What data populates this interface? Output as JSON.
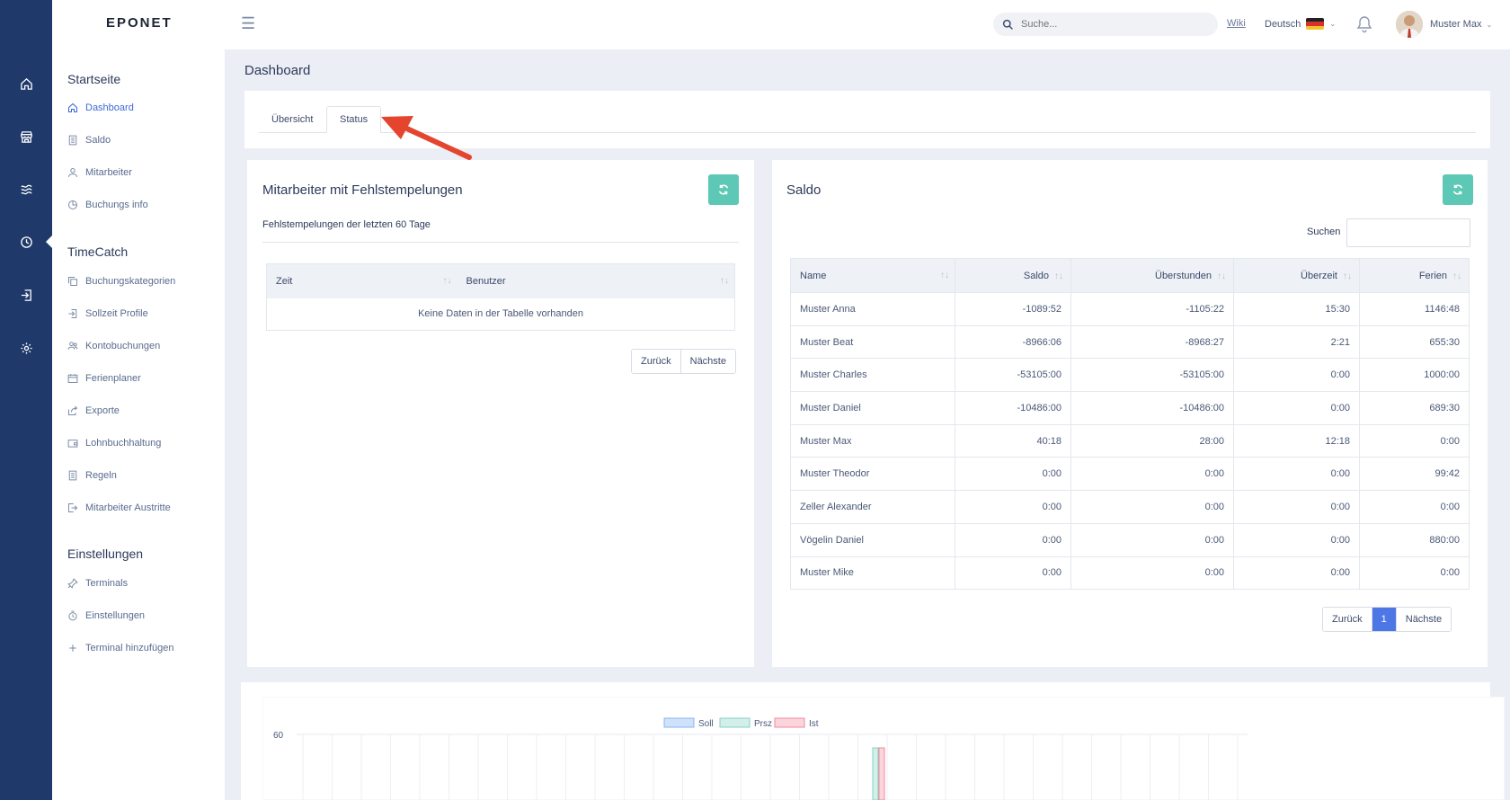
{
  "rail": {
    "icons": [
      "home-icon",
      "store-icon",
      "waves-icon",
      "clock-icon",
      "login-icon",
      "gear-icon"
    ]
  },
  "sidebar": {
    "logo": "EPONET",
    "sections": [
      {
        "title": "Startseite",
        "items": [
          {
            "label": "Dashboard",
            "icon": "home-icon",
            "active": true
          },
          {
            "label": "Saldo",
            "icon": "document-icon"
          },
          {
            "label": "Mitarbeiter",
            "icon": "user-icon"
          },
          {
            "label": "Buchungs info",
            "icon": "pie-icon"
          }
        ]
      },
      {
        "title": "TimeCatch",
        "items": [
          {
            "label": "Buchungskategorien",
            "icon": "copy-icon"
          },
          {
            "label": "Sollzeit Profile",
            "icon": "login-icon"
          },
          {
            "label": "Kontobuchungen",
            "icon": "users-icon"
          },
          {
            "label": "Ferienplaner",
            "icon": "calendar-icon"
          },
          {
            "label": "Exporte",
            "icon": "share-icon"
          },
          {
            "label": "Lohnbuchhaltung",
            "icon": "wallet-icon"
          },
          {
            "label": "Regeln",
            "icon": "document-icon"
          },
          {
            "label": "Mitarbeiter Austritte",
            "icon": "logout-icon"
          }
        ]
      },
      {
        "title": "Einstellungen",
        "items": [
          {
            "label": "Terminals",
            "icon": "pin-icon"
          },
          {
            "label": "Einstellungen",
            "icon": "stopwatch-icon"
          },
          {
            "label": "Terminal hinzufügen",
            "icon": "plus-icon"
          }
        ]
      }
    ]
  },
  "topbar": {
    "search_placeholder": "Suche...",
    "wiki": "Wiki",
    "language": "Deutsch",
    "user_name": "Muster Max"
  },
  "page": {
    "title": "Dashboard",
    "tabs": [
      "Übersicht",
      "Status"
    ],
    "selected_tab": "Status"
  },
  "fehlstempelungen": {
    "title": "Mitarbeiter mit Fehlstempelungen",
    "subtitle": "Fehlstempelungen der letzten 60 Tage",
    "columns": [
      "Zeit",
      "Benutzer"
    ],
    "empty_text": "Keine Daten in der Tabelle vorhanden",
    "prev": "Zurück",
    "next": "Nächste"
  },
  "saldo": {
    "title": "Saldo",
    "search_label": "Suchen",
    "columns": [
      "Name",
      "Saldo",
      "Überstunden",
      "Überzeit",
      "Ferien"
    ],
    "rows": [
      {
        "name": "Muster Anna",
        "saldo": "-1089:52",
        "ueberstunden": "-1105:22",
        "ueberzeit": "15:30",
        "ferien": "1146:48"
      },
      {
        "name": "Muster Beat",
        "saldo": "-8966:06",
        "ueberstunden": "-8968:27",
        "ueberzeit": "2:21",
        "ferien": "655:30"
      },
      {
        "name": "Muster Charles",
        "saldo": "-53105:00",
        "ueberstunden": "-53105:00",
        "ueberzeit": "0:00",
        "ferien": "1000:00"
      },
      {
        "name": "Muster Daniel",
        "saldo": "-10486:00",
        "ueberstunden": "-10486:00",
        "ueberzeit": "0:00",
        "ferien": "689:30"
      },
      {
        "name": "Muster Max",
        "saldo": "40:18",
        "ueberstunden": "28:00",
        "ueberzeit": "12:18",
        "ferien": "0:00"
      },
      {
        "name": "Muster Theodor",
        "saldo": "0:00",
        "ueberstunden": "0:00",
        "ueberzeit": "0:00",
        "ferien": "99:42"
      },
      {
        "name": "Zeller Alexander",
        "saldo": "0:00",
        "ueberstunden": "0:00",
        "ueberzeit": "0:00",
        "ferien": "0:00"
      },
      {
        "name": "Vögelin Daniel",
        "saldo": "0:00",
        "ueberstunden": "0:00",
        "ueberzeit": "0:00",
        "ferien": "880:00"
      },
      {
        "name": "Muster Mike",
        "saldo": "0:00",
        "ueberstunden": "0:00",
        "ueberzeit": "0:00",
        "ferien": "0:00"
      }
    ],
    "prev": "Zurück",
    "current_page": "1",
    "next": "Nächste"
  },
  "chart_data": {
    "type": "bar",
    "legend": [
      "Soll",
      "Prsz",
      "Ist"
    ],
    "legend_colors": [
      "#cfe2fb",
      "#d3efea",
      "#fbd5dc"
    ],
    "y_tick_top": "60"
  },
  "colors": {
    "rail": "#1f3a6a",
    "accent": "#3c6ad6",
    "refresh": "#5dc8b5",
    "negative": "#d8313d",
    "arrow": "#e5442e"
  }
}
